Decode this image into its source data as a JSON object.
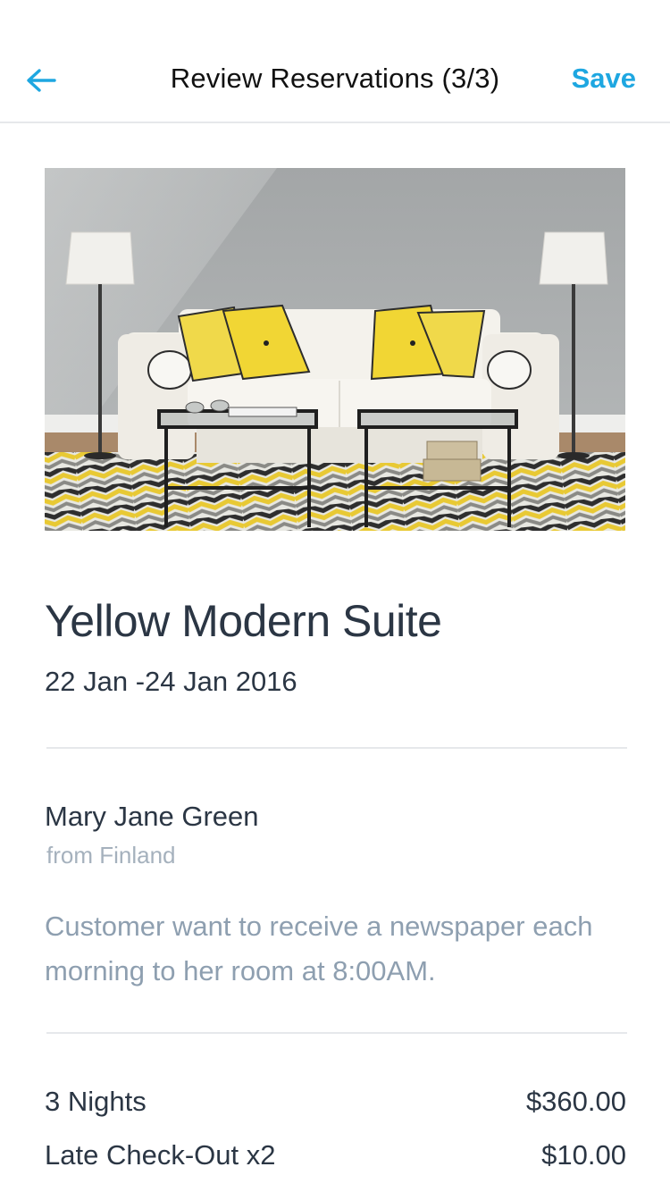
{
  "navbar": {
    "back_icon": "arrow-left-icon",
    "title": "Review Reservations (3/3)",
    "save_label": "Save"
  },
  "colors": {
    "accent": "#1ea7e1",
    "text_primary": "#2b3644",
    "text_secondary": "#8e9fb0",
    "text_muted": "#a5b1bd",
    "divider": "#e6e8eb"
  },
  "room": {
    "title": "Yellow Modern Suite",
    "dates": "22 Jan -24 Jan 2016"
  },
  "guest": {
    "name": "Mary Jane Green",
    "origin": "from Finland",
    "note": "Customer want to receive a newspaper each morning to her room at 8:00AM."
  },
  "charges": [
    {
      "label": "3 Nights",
      "amount": "$360.00"
    },
    {
      "label": "Late Check-Out x2",
      "amount": "$10.00"
    }
  ]
}
